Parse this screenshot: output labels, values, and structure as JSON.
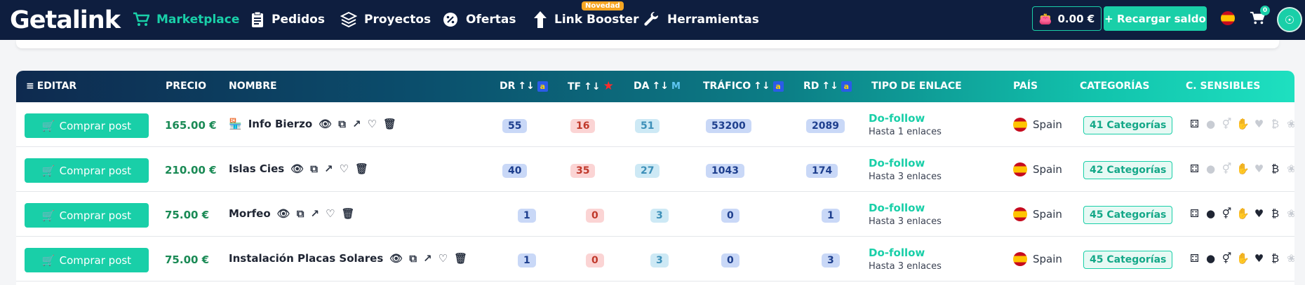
{
  "nav": {
    "logo": "Getalink",
    "items": [
      {
        "label": "Marketplace",
        "icon": "cart-icon"
      },
      {
        "label": "Pedidos",
        "icon": "clipboard-icon"
      },
      {
        "label": "Proyectos",
        "icon": "layers-icon"
      },
      {
        "label": "Ofertas",
        "icon": "discount-icon"
      },
      {
        "label": "Link Booster",
        "icon": "arrow-up-icon"
      },
      {
        "label": "Herramientas",
        "icon": "wrench-icon"
      }
    ],
    "new_badge": "Novedad",
    "balance": "0.00 €",
    "recharge": "+ Recargar saldo",
    "cart_count": "0"
  },
  "table": {
    "headers": {
      "edit": "EDITAR",
      "price": "PRECIO",
      "name": "NOMBRE",
      "dr": "DR",
      "tf": "TF",
      "da": "DA",
      "traffic": "TRÁFICO",
      "rd": "RD",
      "link_type": "TIPO DE ENLACE",
      "country": "PAÍS",
      "categories": "CATEGORÍAS",
      "sensitive": "C. SENSIBLES"
    },
    "buy_label": "Comprar post",
    "rows": [
      {
        "price": "165.00 €",
        "name": "Info Bierzo",
        "dr": "55",
        "tf": "16",
        "da": "51",
        "traffic": "53200",
        "rd": "2089",
        "link_type": "Do-follow",
        "link_limit": "Hasta 1 enlaces",
        "country": "Spain",
        "categories": "41 Categorías"
      },
      {
        "price": "210.00 €",
        "name": "Islas Cies",
        "dr": "40",
        "tf": "35",
        "da": "27",
        "traffic": "1043",
        "rd": "174",
        "link_type": "Do-follow",
        "link_limit": "Hasta 3 enlaces",
        "country": "Spain",
        "categories": "42 Categorías"
      },
      {
        "price": "75.00 €",
        "name": "Morfeo",
        "dr": "1",
        "tf": "0",
        "da": "3",
        "traffic": "0",
        "rd": "1",
        "link_type": "Do-follow",
        "link_limit": "Hasta 3 enlaces",
        "country": "Spain",
        "categories": "45 Categorías"
      },
      {
        "price": "75.00 €",
        "name": "Instalación Placas Solares",
        "dr": "1",
        "tf": "0",
        "da": "3",
        "traffic": "0",
        "rd": "3",
        "link_type": "Do-follow",
        "link_limit": "Hasta 3 enlaces",
        "country": "Spain",
        "categories": "45 Categorías"
      }
    ]
  },
  "colors": {
    "accent": "#19cfa8",
    "nav_bg": "#0e1e3f"
  }
}
